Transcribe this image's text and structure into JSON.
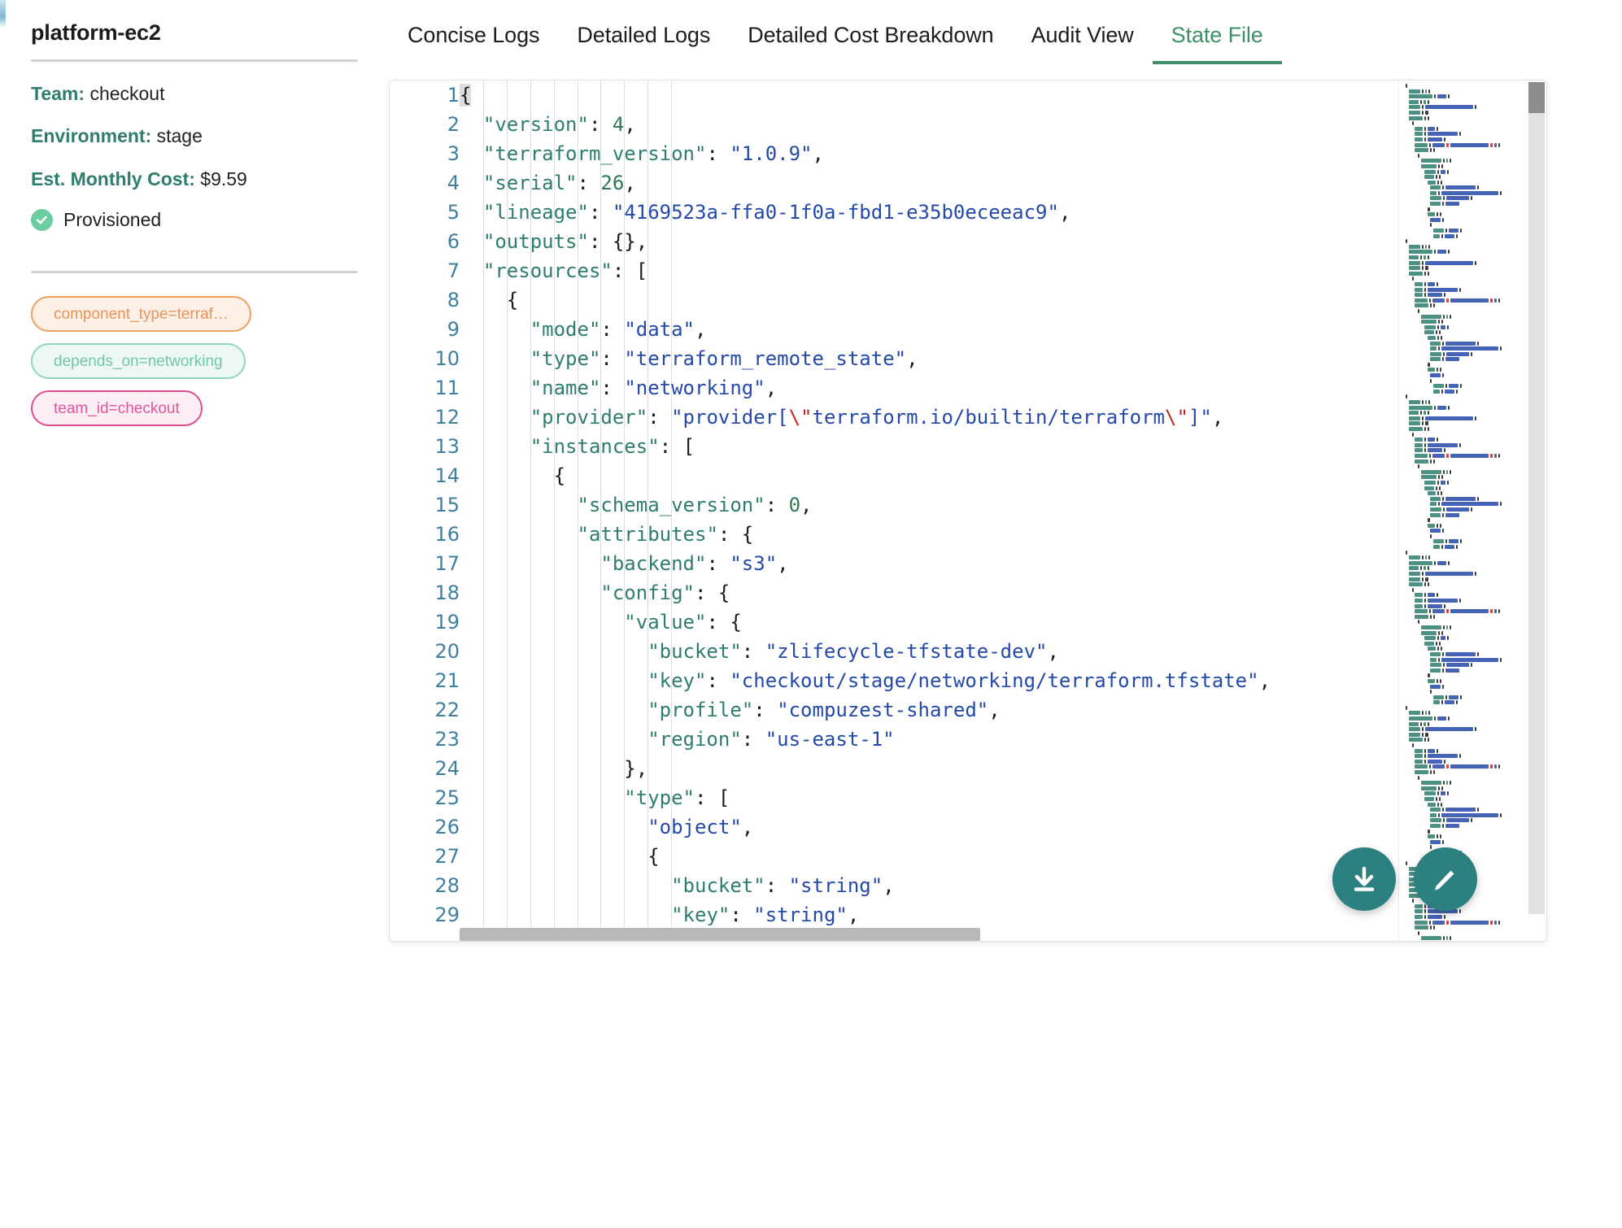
{
  "component": {
    "title": "platform-ec2",
    "team_label": "Team:",
    "team_value": "checkout",
    "environment_label": "Environment:",
    "environment_value": "stage",
    "cost_label": "Est. Monthly Cost:",
    "cost_value": "$9.59",
    "status": "Provisioned",
    "status_color": "#6ccda0",
    "chips": [
      {
        "label": "component_type=terraf…",
        "color": "#e8945a",
        "border": "#ef9f5e",
        "bg": "#fdf0e6"
      },
      {
        "label": "depends_on=networking",
        "color": "#71c7a8",
        "border": "#8fd6bc",
        "bg": "#edf8f3"
      },
      {
        "label": "team_id=checkout",
        "color": "#e2559a",
        "border": "#e14b8f",
        "bg": "#fceef5"
      }
    ]
  },
  "tabs": [
    {
      "label": "Concise Logs",
      "active": false
    },
    {
      "label": "Detailed Logs",
      "active": false
    },
    {
      "label": "Detailed Cost Breakdown",
      "active": false
    },
    {
      "label": "Audit View",
      "active": false
    },
    {
      "label": "State File",
      "active": true
    }
  ],
  "tab_active_color": "#3f8f68",
  "editor": {
    "language": "json",
    "first_visible_line": 1,
    "last_visible_line": 29,
    "total_lines_hint": 29,
    "lines": [
      {
        "n": 1,
        "tokens": [
          {
            "t": "{",
            "c": "p",
            "hl": true
          }
        ]
      },
      {
        "n": 2,
        "tokens": [
          {
            "t": "  ",
            "c": "p"
          },
          {
            "t": "\"version\"",
            "c": "k"
          },
          {
            "t": ": ",
            "c": "p"
          },
          {
            "t": "4",
            "c": "n"
          },
          {
            "t": ",",
            "c": "p"
          }
        ]
      },
      {
        "n": 3,
        "tokens": [
          {
            "t": "  ",
            "c": "p"
          },
          {
            "t": "\"terraform_version\"",
            "c": "k"
          },
          {
            "t": ": ",
            "c": "p"
          },
          {
            "t": "\"1.0.9\"",
            "c": "s"
          },
          {
            "t": ",",
            "c": "p"
          }
        ]
      },
      {
        "n": 4,
        "tokens": [
          {
            "t": "  ",
            "c": "p"
          },
          {
            "t": "\"serial\"",
            "c": "k"
          },
          {
            "t": ": ",
            "c": "p"
          },
          {
            "t": "26",
            "c": "n"
          },
          {
            "t": ",",
            "c": "p"
          }
        ]
      },
      {
        "n": 5,
        "tokens": [
          {
            "t": "  ",
            "c": "p"
          },
          {
            "t": "\"lineage\"",
            "c": "k"
          },
          {
            "t": ": ",
            "c": "p"
          },
          {
            "t": "\"4169523a-ffa0-1f0a-fbd1-e35b0eceeac9\"",
            "c": "s"
          },
          {
            "t": ",",
            "c": "p"
          }
        ]
      },
      {
        "n": 6,
        "tokens": [
          {
            "t": "  ",
            "c": "p"
          },
          {
            "t": "\"outputs\"",
            "c": "k"
          },
          {
            "t": ": ",
            "c": "p"
          },
          {
            "t": "{},",
            "c": "p"
          }
        ]
      },
      {
        "n": 7,
        "tokens": [
          {
            "t": "  ",
            "c": "p"
          },
          {
            "t": "\"resources\"",
            "c": "k"
          },
          {
            "t": ": ",
            "c": "p"
          },
          {
            "t": "[",
            "c": "p"
          }
        ]
      },
      {
        "n": 8,
        "tokens": [
          {
            "t": "    {",
            "c": "p"
          }
        ]
      },
      {
        "n": 9,
        "tokens": [
          {
            "t": "      ",
            "c": "p"
          },
          {
            "t": "\"mode\"",
            "c": "k"
          },
          {
            "t": ": ",
            "c": "p"
          },
          {
            "t": "\"data\"",
            "c": "s"
          },
          {
            "t": ",",
            "c": "p"
          }
        ]
      },
      {
        "n": 10,
        "tokens": [
          {
            "t": "      ",
            "c": "p"
          },
          {
            "t": "\"type\"",
            "c": "k"
          },
          {
            "t": ": ",
            "c": "p"
          },
          {
            "t": "\"terraform_remote_state\"",
            "c": "s"
          },
          {
            "t": ",",
            "c": "p"
          }
        ]
      },
      {
        "n": 11,
        "tokens": [
          {
            "t": "      ",
            "c": "p"
          },
          {
            "t": "\"name\"",
            "c": "k"
          },
          {
            "t": ": ",
            "c": "p"
          },
          {
            "t": "\"networking\"",
            "c": "s"
          },
          {
            "t": ",",
            "c": "p"
          }
        ]
      },
      {
        "n": 12,
        "tokens": [
          {
            "t": "      ",
            "c": "p"
          },
          {
            "t": "\"provider\"",
            "c": "k"
          },
          {
            "t": ": ",
            "c": "p"
          },
          {
            "t": "\"provider[",
            "c": "s"
          },
          {
            "t": "\\\"",
            "c": "esc"
          },
          {
            "t": "terraform.io/builtin/terraform",
            "c": "s"
          },
          {
            "t": "\\\"",
            "c": "esc"
          },
          {
            "t": "]\"",
            "c": "s"
          },
          {
            "t": ",",
            "c": "p"
          }
        ]
      },
      {
        "n": 13,
        "tokens": [
          {
            "t": "      ",
            "c": "p"
          },
          {
            "t": "\"instances\"",
            "c": "k"
          },
          {
            "t": ": ",
            "c": "p"
          },
          {
            "t": "[",
            "c": "p"
          }
        ]
      },
      {
        "n": 14,
        "tokens": [
          {
            "t": "        {",
            "c": "p"
          }
        ]
      },
      {
        "n": 15,
        "tokens": [
          {
            "t": "          ",
            "c": "p"
          },
          {
            "t": "\"schema_version\"",
            "c": "k"
          },
          {
            "t": ": ",
            "c": "p"
          },
          {
            "t": "0",
            "c": "n"
          },
          {
            "t": ",",
            "c": "p"
          }
        ]
      },
      {
        "n": 16,
        "tokens": [
          {
            "t": "          ",
            "c": "p"
          },
          {
            "t": "\"attributes\"",
            "c": "k"
          },
          {
            "t": ": ",
            "c": "p"
          },
          {
            "t": "{",
            "c": "p"
          }
        ]
      },
      {
        "n": 17,
        "tokens": [
          {
            "t": "            ",
            "c": "p"
          },
          {
            "t": "\"backend\"",
            "c": "k"
          },
          {
            "t": ": ",
            "c": "p"
          },
          {
            "t": "\"s3\"",
            "c": "s"
          },
          {
            "t": ",",
            "c": "p"
          }
        ]
      },
      {
        "n": 18,
        "tokens": [
          {
            "t": "            ",
            "c": "p"
          },
          {
            "t": "\"config\"",
            "c": "k"
          },
          {
            "t": ": ",
            "c": "p"
          },
          {
            "t": "{",
            "c": "p"
          }
        ]
      },
      {
        "n": 19,
        "tokens": [
          {
            "t": "              ",
            "c": "p"
          },
          {
            "t": "\"value\"",
            "c": "k"
          },
          {
            "t": ": ",
            "c": "p"
          },
          {
            "t": "{",
            "c": "p"
          }
        ]
      },
      {
        "n": 20,
        "tokens": [
          {
            "t": "                ",
            "c": "p"
          },
          {
            "t": "\"bucket\"",
            "c": "k"
          },
          {
            "t": ": ",
            "c": "p"
          },
          {
            "t": "\"zlifecycle-tfstate-dev\"",
            "c": "s"
          },
          {
            "t": ",",
            "c": "p"
          }
        ]
      },
      {
        "n": 21,
        "tokens": [
          {
            "t": "                ",
            "c": "p"
          },
          {
            "t": "\"key\"",
            "c": "k"
          },
          {
            "t": ": ",
            "c": "p"
          },
          {
            "t": "\"checkout/stage/networking/terraform.tfstate\"",
            "c": "s"
          },
          {
            "t": ",",
            "c": "p"
          }
        ]
      },
      {
        "n": 22,
        "tokens": [
          {
            "t": "                ",
            "c": "p"
          },
          {
            "t": "\"profile\"",
            "c": "k"
          },
          {
            "t": ": ",
            "c": "p"
          },
          {
            "t": "\"compuzest-shared\"",
            "c": "s"
          },
          {
            "t": ",",
            "c": "p"
          }
        ]
      },
      {
        "n": 23,
        "tokens": [
          {
            "t": "                ",
            "c": "p"
          },
          {
            "t": "\"region\"",
            "c": "k"
          },
          {
            "t": ": ",
            "c": "p"
          },
          {
            "t": "\"us-east-1\"",
            "c": "s"
          }
        ]
      },
      {
        "n": 24,
        "tokens": [
          {
            "t": "              },",
            "c": "p"
          }
        ]
      },
      {
        "n": 25,
        "tokens": [
          {
            "t": "              ",
            "c": "p"
          },
          {
            "t": "\"type\"",
            "c": "k"
          },
          {
            "t": ": ",
            "c": "p"
          },
          {
            "t": "[",
            "c": "p"
          }
        ]
      },
      {
        "n": 26,
        "tokens": [
          {
            "t": "                ",
            "c": "p"
          },
          {
            "t": "\"object\"",
            "c": "s"
          },
          {
            "t": ",",
            "c": "p"
          }
        ]
      },
      {
        "n": 27,
        "tokens": [
          {
            "t": "                {",
            "c": "p"
          }
        ]
      },
      {
        "n": 28,
        "tokens": [
          {
            "t": "                  ",
            "c": "p"
          },
          {
            "t": "\"bucket\"",
            "c": "k"
          },
          {
            "t": ": ",
            "c": "p"
          },
          {
            "t": "\"string\"",
            "c": "s"
          },
          {
            "t": ",",
            "c": "p"
          }
        ]
      },
      {
        "n": 29,
        "tokens": [
          {
            "t": "                  ",
            "c": "p"
          },
          {
            "t": "\"key\"",
            "c": "k"
          },
          {
            "t": ": ",
            "c": "p"
          },
          {
            "t": "\"string\"",
            "c": "s"
          },
          {
            "t": ",",
            "c": "p"
          }
        ]
      }
    ],
    "colors": {
      "key": "#2e7d6e",
      "string": "#2449a8",
      "number": "#2f7a4e",
      "punctuation": "#1a1a1a",
      "escape": "#c2271f",
      "line_number": "#3f7f9e",
      "background": "#ffffff"
    }
  },
  "actions": {
    "download": "download-icon",
    "edit": "edit-icon",
    "fab_color": "#2c8080"
  }
}
